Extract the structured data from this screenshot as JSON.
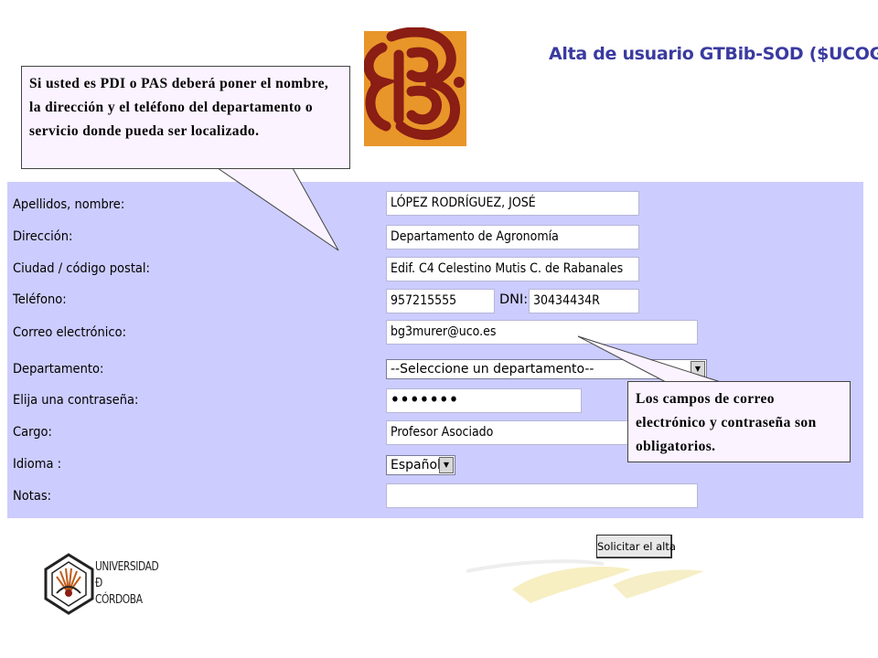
{
  "header": {
    "title": "Alta de usuario GTBib-SOD ($UCOG"
  },
  "form": {
    "fields": {
      "name": {
        "label": "Apellidos, nombre:",
        "value": "LÓPEZ RODRÍGUEZ, JOSÉ"
      },
      "address": {
        "label": "Dirección:",
        "value": "Departamento de Agronomía"
      },
      "city": {
        "label": "Ciudad / código postal:",
        "value": "Edif. C4 Celestino Mutis C. de Rabanales"
      },
      "phone": {
        "label": "Teléfono:",
        "value": "957215555"
      },
      "dni": {
        "label": "DNI:",
        "value": "30434434R"
      },
      "email": {
        "label": "Correo electrónico:",
        "value": "bg3murer@uco.es"
      },
      "department": {
        "label": "Departamento:",
        "value": "--Seleccione un departamento--"
      },
      "password": {
        "label": "Elija una contraseña:",
        "value": "•••••••"
      },
      "position": {
        "label": "Cargo:",
        "value": "Profesor Asociado"
      },
      "language": {
        "label": "Idioma :",
        "value": "Español"
      },
      "notes": {
        "label": "Notas:",
        "value": ""
      }
    },
    "submit_label": "Solicitar el alta"
  },
  "callouts": {
    "pdi_pas": "Si usted es PDI o PAS deberá poner el nombre, la dirección y el teléfono del departamento o servicio donde pueda ser localizado.",
    "required": "Los campos de correo electrónico y contraseña son obligatorios."
  },
  "footer": {
    "university_lines": [
      "UNIVERSIDAD",
      "Ð",
      "CÓRDOBA"
    ]
  },
  "colors": {
    "panel": "#ccccff",
    "title": "#3a3aa0",
    "callout_bg": "#fbf3ff",
    "logo_orange": "#e8962a",
    "logo_red": "#8a1d14"
  }
}
